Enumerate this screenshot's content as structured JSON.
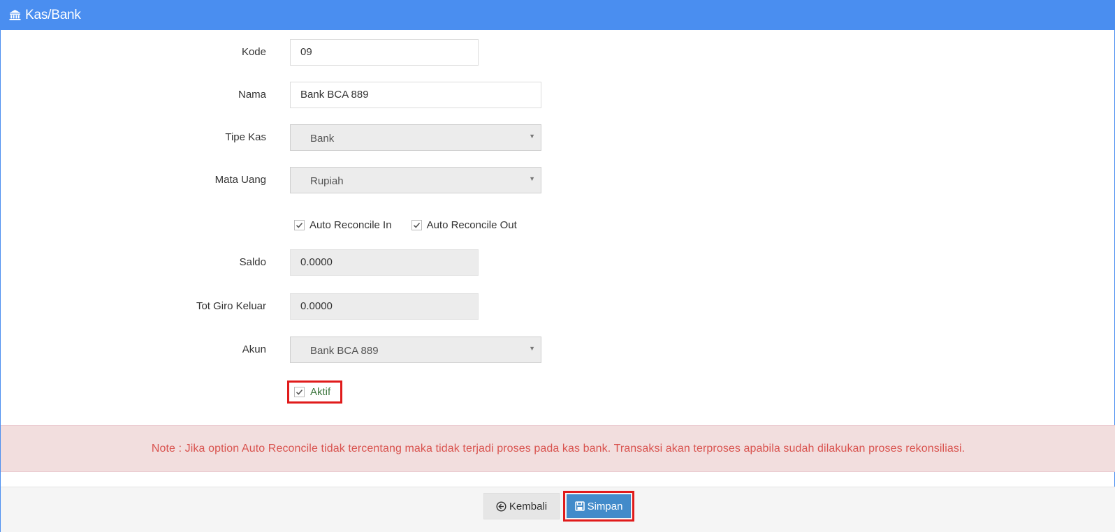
{
  "header": {
    "title": "Kas/Bank",
    "icon": "bank-icon"
  },
  "form": {
    "kode": {
      "label": "Kode",
      "value": "09"
    },
    "nama": {
      "label": "Nama",
      "value": "Bank BCA 889"
    },
    "tipe_kas": {
      "label": "Tipe Kas",
      "value": "Bank"
    },
    "mata_uang": {
      "label": "Mata Uang",
      "value": "Rupiah"
    },
    "auto_reconcile_in": {
      "label": "Auto Reconcile In",
      "checked": true
    },
    "auto_reconcile_out": {
      "label": "Auto Reconcile Out",
      "checked": true
    },
    "saldo": {
      "label": "Saldo",
      "value": "0.0000"
    },
    "tot_giro_keluar": {
      "label": "Tot Giro Keluar",
      "value": "0.0000"
    },
    "akun": {
      "label": "Akun",
      "value": "Bank BCA 889"
    },
    "aktif": {
      "label": "Aktif",
      "checked": true
    }
  },
  "note": "Note : Jika option Auto Reconcile tidak tercentang maka tidak terjadi proses pada kas bank. Transaksi akan terproses apabila sudah dilakukan proses rekonsiliasi.",
  "footer": {
    "back_label": "Kembali",
    "save_label": "Simpan"
  },
  "colors": {
    "header": "#4a8ef0",
    "primary_button": "#428bca",
    "highlight": "#e01b1b",
    "note_bg": "#f2dede",
    "note_text": "#d9534f",
    "aktif_text": "#3c763d"
  }
}
